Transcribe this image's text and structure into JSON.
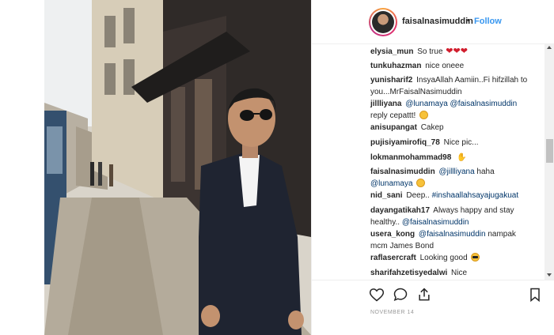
{
  "post": {
    "username": "faisalnasimuddin",
    "separator": "•",
    "follow_label": "Follow",
    "date": "NOVEMBER 14"
  },
  "comments": [
    {
      "user": "elysia_mun",
      "text": "So true",
      "emoji": "hearts"
    },
    {
      "user": "tunkuhazman",
      "text": "nice oneee"
    },
    {
      "user": "yunisharif2",
      "text": "InsyaAllah Aamiin..Fi hifzillah to",
      "text2": "you...MrFaisalNasimuddin"
    },
    {
      "user": "jillliyana",
      "mentions": [
        "@lunamaya",
        "@faisalnasimuddin"
      ],
      "text2": "reply cepattt!",
      "emoji": "smile"
    },
    {
      "user": "anisupangat",
      "text": "Cakep"
    },
    {
      "user": "pujisiyamirofiq_78",
      "text": "Nice pic..."
    },
    {
      "user": "lokmanmohammad98",
      "emoji": "thumbs-up"
    },
    {
      "user": "faisalnasimuddin",
      "mentions": [
        "@jillliyana"
      ],
      "text": "haha",
      "mention2": "@lunamaya",
      "emoji": "smile"
    },
    {
      "user": "nid_sani",
      "text": "Deep..",
      "mention2": "#inshaallahsayajugakuat"
    },
    {
      "user": "dayangatikah17",
      "text": "Always happy and stay",
      "text2": "healthy..",
      "mention2": "@faisalnasimuddin"
    },
    {
      "user": "usera_kong",
      "mentions": [
        "@faisalnasimuddin"
      ],
      "text": "nampak",
      "text2": "mcm James Bond"
    },
    {
      "user": "raflasercraft",
      "text": "Looking good",
      "emoji": "sunglasses"
    },
    {
      "user": "sharifahzetisyedalwi",
      "text": "Nice"
    }
  ],
  "icons": {
    "like": "heart-icon",
    "comment": "comment-icon",
    "share": "share-icon",
    "save": "bookmark-icon"
  },
  "colors": {
    "link": "#3897f0",
    "mention": "#003569",
    "text": "#262626",
    "meta": "#999999"
  }
}
